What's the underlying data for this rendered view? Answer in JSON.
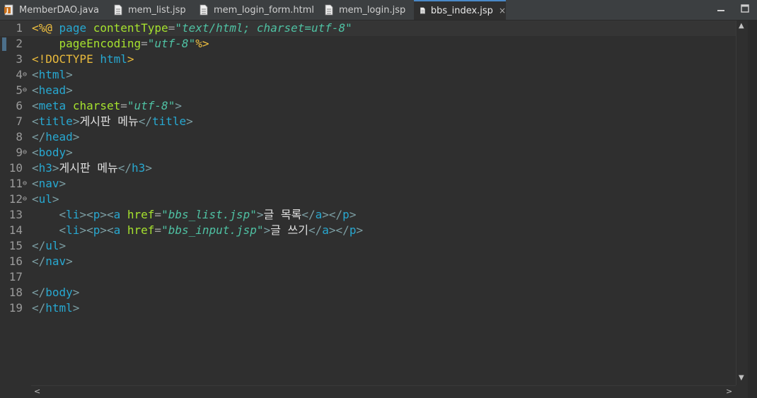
{
  "tabs": [
    {
      "label": "MemberDAO.java",
      "icon": "java-file-icon"
    },
    {
      "label": "mem_list.jsp",
      "icon": "jsp-file-icon"
    },
    {
      "label": "mem_login_form.html",
      "icon": "html-file-icon"
    },
    {
      "label": "mem_login.jsp",
      "icon": "jsp-file-icon"
    },
    {
      "label": "bbs_index.jsp",
      "icon": "jsp-file-icon",
      "active": true,
      "close": "×"
    }
  ],
  "window_controls": [
    "minimize-icon",
    "maximize-icon"
  ],
  "line_numbers": [
    "1",
    "2",
    "3",
    "4",
    "5",
    "6",
    "7",
    "8",
    "9",
    "10",
    "11",
    "12",
    "13",
    "14",
    "15",
    "16",
    "17",
    "18",
    "19"
  ],
  "fold_marker": "⊖",
  "code": {
    "l1": [
      "<%@",
      " ",
      "page",
      " ",
      "contentType",
      "=",
      "\"text/html; charset=utf-8\""
    ],
    "l2": [
      "    ",
      "pageEncoding",
      "=",
      "\"utf-8\"",
      "%>"
    ],
    "l3": [
      "<!DOCTYPE",
      " ",
      "html",
      ">"
    ],
    "l4": [
      "<",
      "html",
      ">"
    ],
    "l5": [
      "<",
      "head",
      ">"
    ],
    "l6": [
      "<",
      "meta",
      " ",
      "charset",
      "=",
      "\"utf-8\"",
      ">"
    ],
    "l7": [
      "<",
      "title",
      ">",
      "게시판 메뉴",
      "</",
      "title",
      ">"
    ],
    "l8": [
      "</",
      "head",
      ">"
    ],
    "l9": [
      "<",
      "body",
      ">"
    ],
    "l10": [
      "<",
      "h3",
      ">",
      "게시판 메뉴",
      "</",
      "h3",
      ">"
    ],
    "l11": [
      "<",
      "nav",
      ">"
    ],
    "l12": [
      "<",
      "ul",
      ">"
    ],
    "l13": [
      "    ",
      "<",
      "li",
      "><",
      "p",
      "><",
      "a",
      " ",
      "href",
      "=",
      "\"bbs_list.jsp\"",
      ">",
      "글 목록",
      "</",
      "a",
      "></",
      "p",
      ">"
    ],
    "l14": [
      "    ",
      "<",
      "li",
      "><",
      "p",
      "><",
      "a",
      " ",
      "href",
      "=",
      "\"bbs_input.jsp\"",
      ">",
      "글 쓰기",
      "</",
      "a",
      "></",
      "p",
      ">"
    ],
    "l15": [
      "</",
      "ul",
      ">"
    ],
    "l16": [
      "</",
      "nav",
      ">"
    ],
    "l17": [],
    "l18": [
      "</",
      "body",
      ">"
    ],
    "l19": [
      "</",
      "html",
      ">"
    ]
  },
  "scroll": {
    "up": "▲",
    "down": "▼",
    "left": "<",
    "right": ">"
  }
}
